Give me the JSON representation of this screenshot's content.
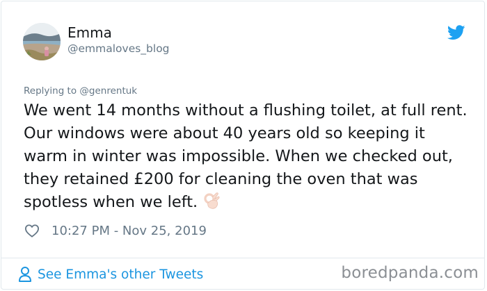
{
  "author": {
    "display_name": "Emma",
    "handle": "@emmaloves_blog",
    "avatar_icon": "profile-photo-avatar"
  },
  "brand": {
    "icon": "twitter-bird-icon",
    "color": "#1da1f2"
  },
  "reply": {
    "label": "Replying to @genrentuk"
  },
  "tweet": {
    "text": "We went 14 months without a flushing toilet, at full rent. Our windows were about 40 years old so keeping it warm in winter was impossible. When we checked out, they retained £200 for cleaning the oven that was spotless when we left.",
    "emoji": "ok-hand-emoji"
  },
  "meta": {
    "like_icon": "heart-icon",
    "timestamp": "10:27 PM - Nov 25, 2019"
  },
  "footer": {
    "see_more_label": "See Emma's other Tweets",
    "see_more_icon": "person-icon",
    "link_color": "#1b95e0"
  },
  "watermark": {
    "text": "boredpanda.com"
  }
}
